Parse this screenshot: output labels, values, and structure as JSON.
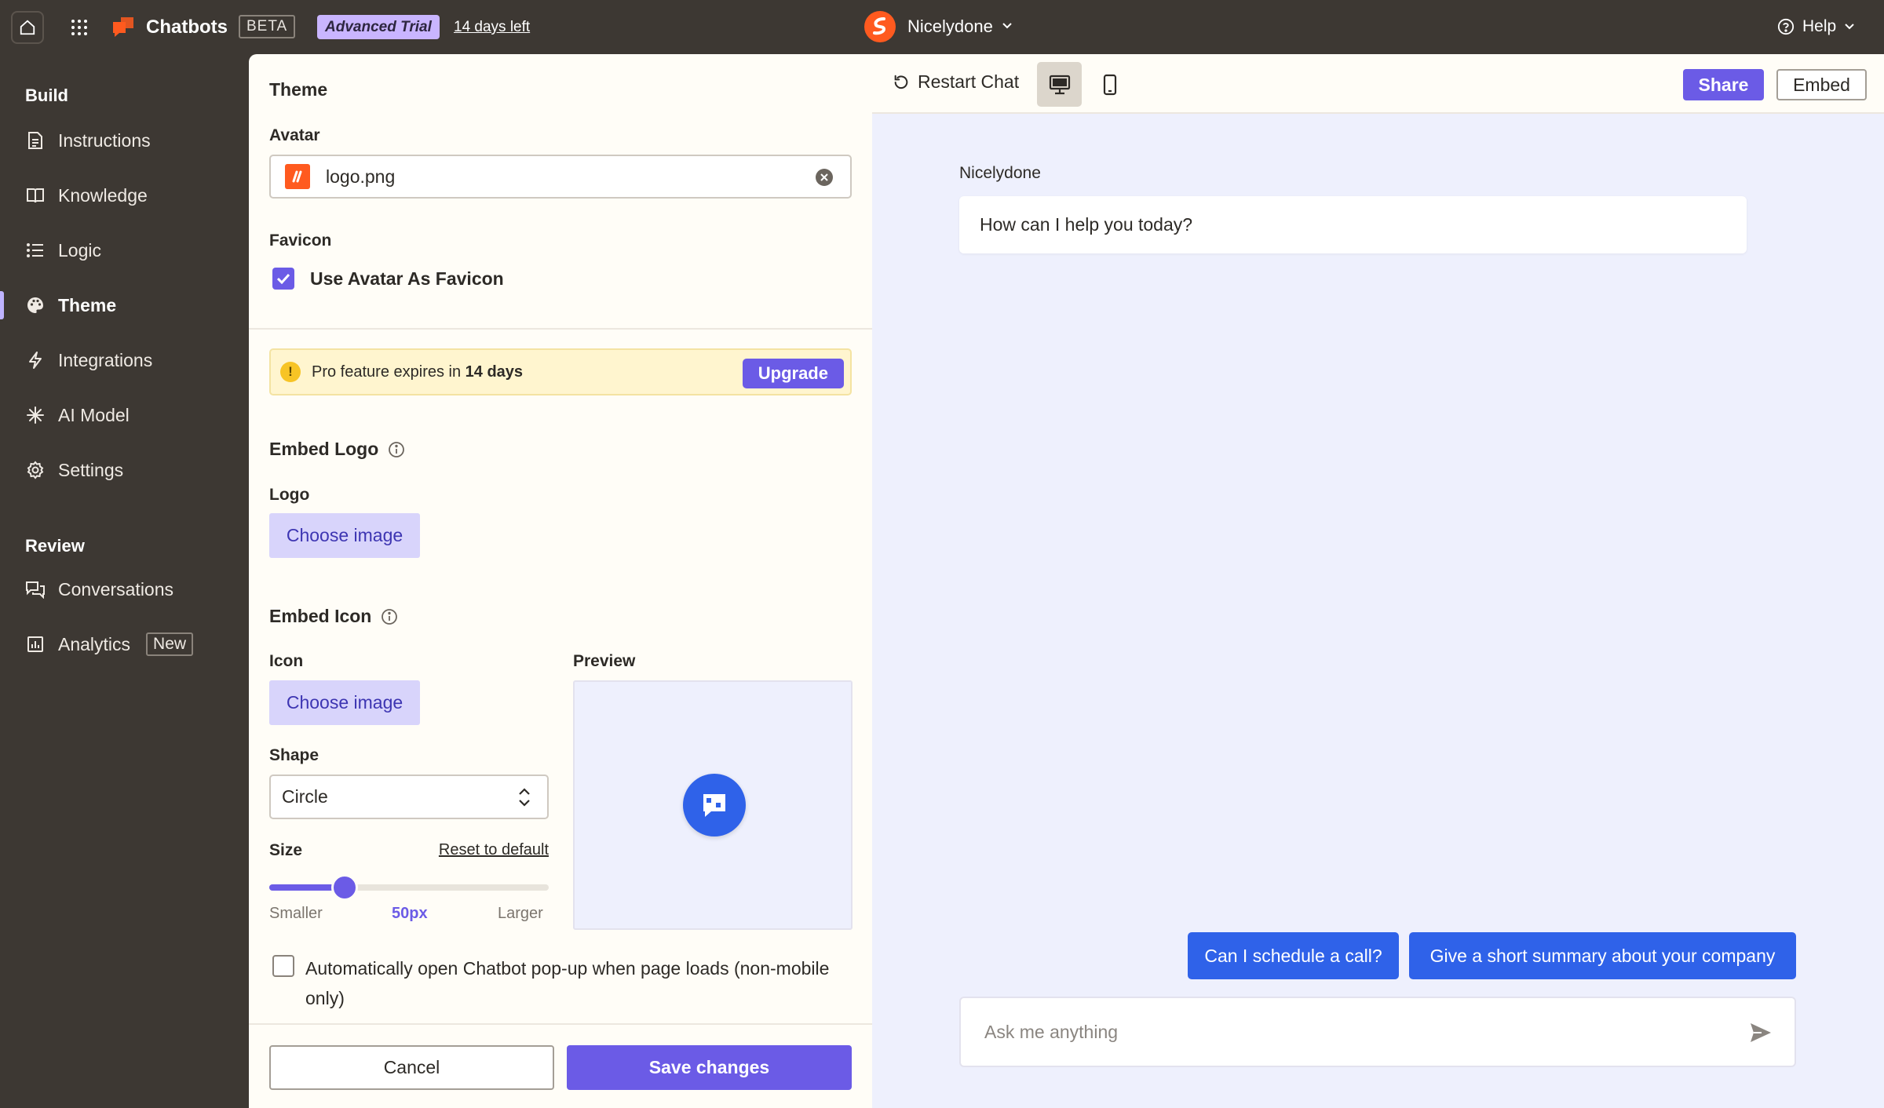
{
  "topbar": {
    "app_name": "Chatbots",
    "beta_badge": "BETA",
    "trial_badge": "Advanced Trial",
    "days_left": "14 days left",
    "workspace": "Nicelydone",
    "help": "Help"
  },
  "sidebar": {
    "build_heading": "Build",
    "items": [
      {
        "label": "Instructions",
        "icon": "document-icon"
      },
      {
        "label": "Knowledge",
        "icon": "book-icon"
      },
      {
        "label": "Logic",
        "icon": "list-icon"
      },
      {
        "label": "Theme",
        "icon": "palette-icon",
        "active": true
      },
      {
        "label": "Integrations",
        "icon": "bolt-icon"
      },
      {
        "label": "AI Model",
        "icon": "sparkle-icon"
      },
      {
        "label": "Settings",
        "icon": "gear-icon"
      }
    ],
    "review_heading": "Review",
    "review_items": [
      {
        "label": "Conversations",
        "icon": "chat-bubbles-icon"
      },
      {
        "label": "Analytics",
        "icon": "chart-icon",
        "badge": "New"
      }
    ]
  },
  "panel": {
    "title": "Theme",
    "avatar_label": "Avatar",
    "avatar_file": "logo.png",
    "favicon_label": "Favicon",
    "favicon_checkbox": "Use Avatar As Favicon",
    "favicon_checked": true,
    "promo_prefix": "Pro feature expires in ",
    "promo_days": "14 days",
    "upgrade": "Upgrade",
    "embed_logo_heading": "Embed Logo",
    "logo_label": "Logo",
    "choose_image": "Choose image",
    "embed_icon_heading": "Embed Icon",
    "icon_label": "Icon",
    "preview_label": "Preview",
    "shape_label": "Shape",
    "shape_value": "Circle",
    "size_label": "Size",
    "reset_default": "Reset to default",
    "size_smaller": "Smaller",
    "size_value": "50px",
    "size_larger": "Larger",
    "size_fraction": 0.27,
    "auto_open": "Automatically open Chatbot pop-up when page loads (non-mobile only)",
    "auto_open_checked": false,
    "cancel": "Cancel",
    "save": "Save changes"
  },
  "preview": {
    "restart": "Restart Chat",
    "share": "Share",
    "embed": "Embed",
    "bot_name": "Nicelydone",
    "greeting": "How can I help you today?",
    "suggestions": [
      "Can I schedule a call?",
      "Give a short summary about your company"
    ],
    "input_placeholder": "Ask me anything"
  },
  "colors": {
    "accent": "#6b5be6",
    "chat_blue": "#2f62e9",
    "brand_orange": "#ff5a1f",
    "sidebar_bg": "#3d3833"
  }
}
